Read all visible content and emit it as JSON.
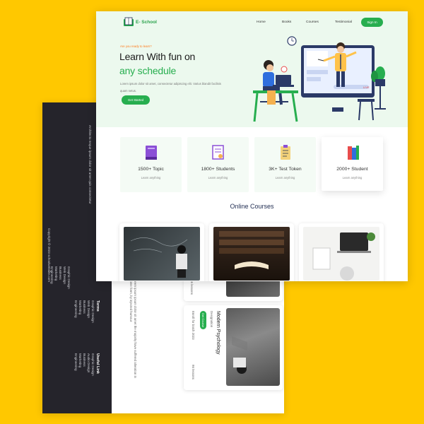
{
  "site": {
    "logo_text": "E- School",
    "nav": [
      "Home",
      "Books",
      "Courses",
      "Testimonial"
    ],
    "signin_label": "Sign In",
    "hero": {
      "tagline": "Are you ready to learn?",
      "title_line1": "Learn With fun on",
      "title_line2": "any schedule",
      "description": "Lorem ipsum dolor sit amet, consectetur adipiscing elit. Varius blandit facilisis quam netus.",
      "cta_label": "Get Started"
    },
    "stats": [
      {
        "title": "1500+ Topic",
        "subtitle": "Learn anything",
        "icon": "book-icon"
      },
      {
        "title": "1800+ Students",
        "subtitle": "Learn anything",
        "icon": "certificate-icon"
      },
      {
        "title": "3K+ Test Token",
        "subtitle": "Learn anything",
        "icon": "clipboard-icon"
      },
      {
        "title": "2000+ Student",
        "subtitle": "Learn anything",
        "icon": "books-stack-icon"
      }
    ],
    "section_title": "Online Courses"
  },
  "back_page": {
    "footer_description": "Architecto neque ipsum dolor sit amet quis consectetur",
    "footer_copyright": "Copyright © 2023 schoolwebsite.com",
    "footer_column_a": [
      "Graphic Design",
      "Web Design",
      "Business",
      "Marketing",
      "Engineering"
    ],
    "footer_terms_heading": "Terms",
    "footer_terms": [
      "Graphic Design",
      "Web Design",
      "Business",
      "Marketing",
      "Engineering"
    ],
    "footer_useful_heading": "Useful Link",
    "footer_useful": [
      "Graphic Design",
      "Audio Design",
      "Business",
      "Marketing",
      "Engineering"
    ],
    "body_text": "lorem ipsum ipsum dolor sit amet the majority have suffered alteration in some form, by injected humour",
    "course_title": "Modern Psychology",
    "course_subtitle": "Designation",
    "course_button": "Get Course",
    "course_meta": "Enroll for batch 2023",
    "course_lessons": "86 lessons",
    "course_lessons2": "86 lessons"
  },
  "colors": {
    "accent": "#27ae4f",
    "background": "#ffc800",
    "footer": "#25242b",
    "orange": "#ff7a1a"
  }
}
